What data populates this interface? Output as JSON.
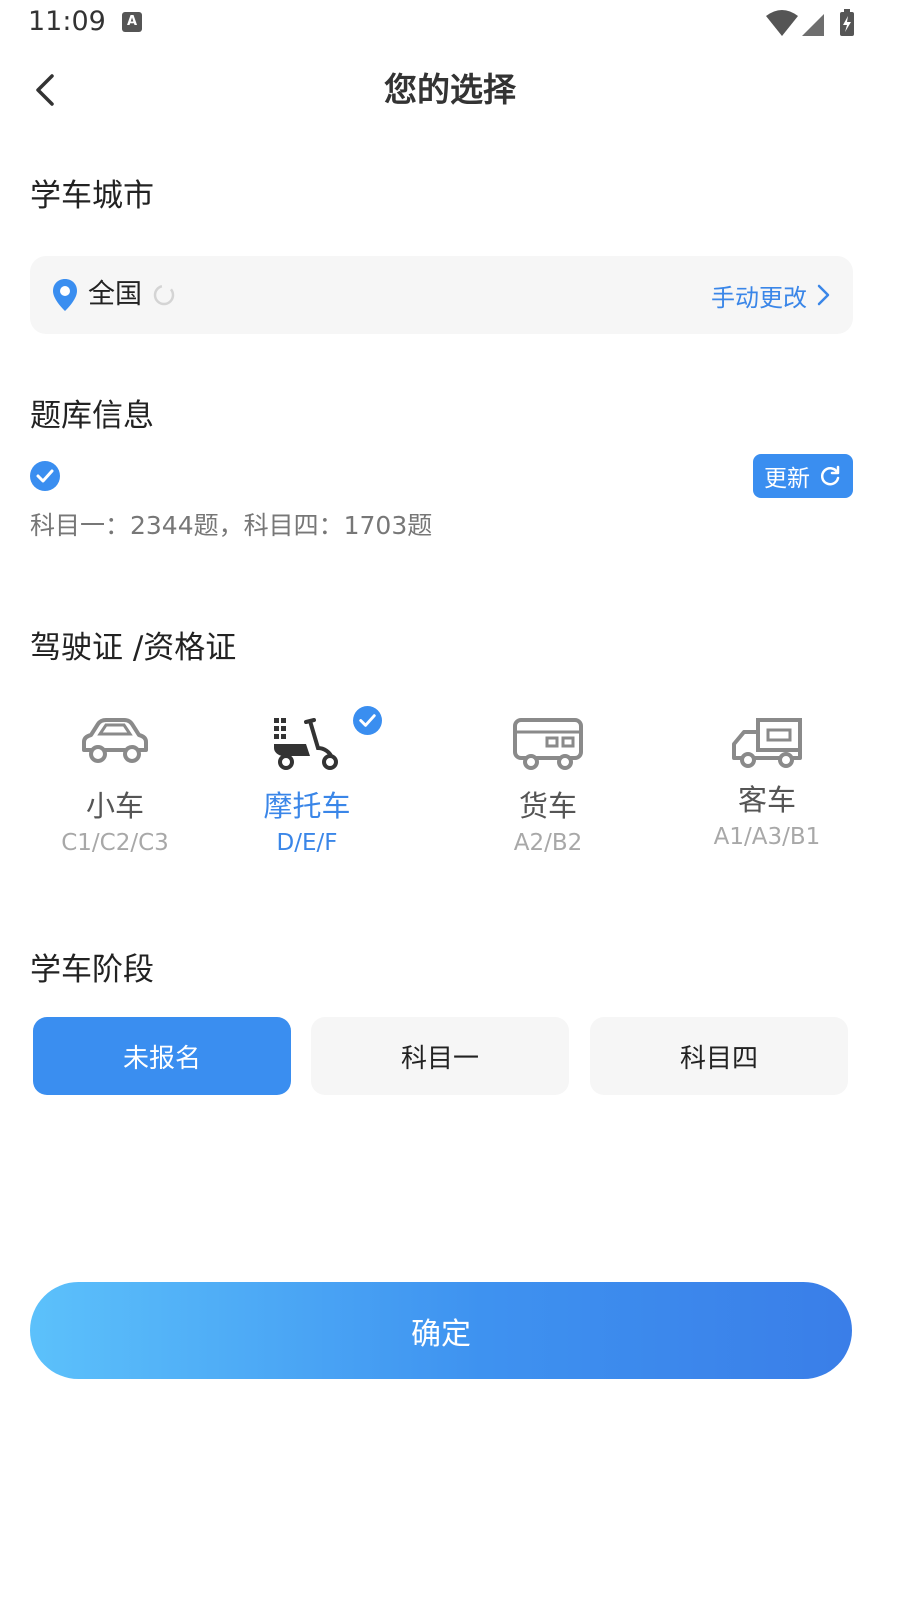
{
  "status_bar": {
    "time": "11:09",
    "a_badge": "A"
  },
  "header": {
    "title": "您的选择"
  },
  "city": {
    "section_title": "学车城市",
    "current": "全国",
    "change_label": "手动更改"
  },
  "bank": {
    "section_title": "题库信息",
    "update_label": "更新",
    "count_text": "科目一：2344题，科目四：1703题"
  },
  "license": {
    "section_title": "驾驶证 /资格证",
    "types": [
      {
        "name": "小车",
        "code": "C1/C2/C3",
        "icon": "car-icon"
      },
      {
        "name": "摩托车",
        "code": "D/E/F",
        "icon": "motorcycle-icon",
        "selected": true
      },
      {
        "name": "货车",
        "code": "A2/B2",
        "icon": "bus-icon"
      },
      {
        "name": "客车",
        "code": "A1/A3/B1",
        "icon": "truck-icon"
      }
    ]
  },
  "stage": {
    "section_title": "学车阶段",
    "options": [
      "未报名",
      "科目一",
      "科目四"
    ],
    "selected": "未报名"
  },
  "confirm_label": "确定",
  "colors": {
    "accent": "#3a8ef0",
    "link": "#3a86e8",
    "panel": "#f6f6f6"
  }
}
